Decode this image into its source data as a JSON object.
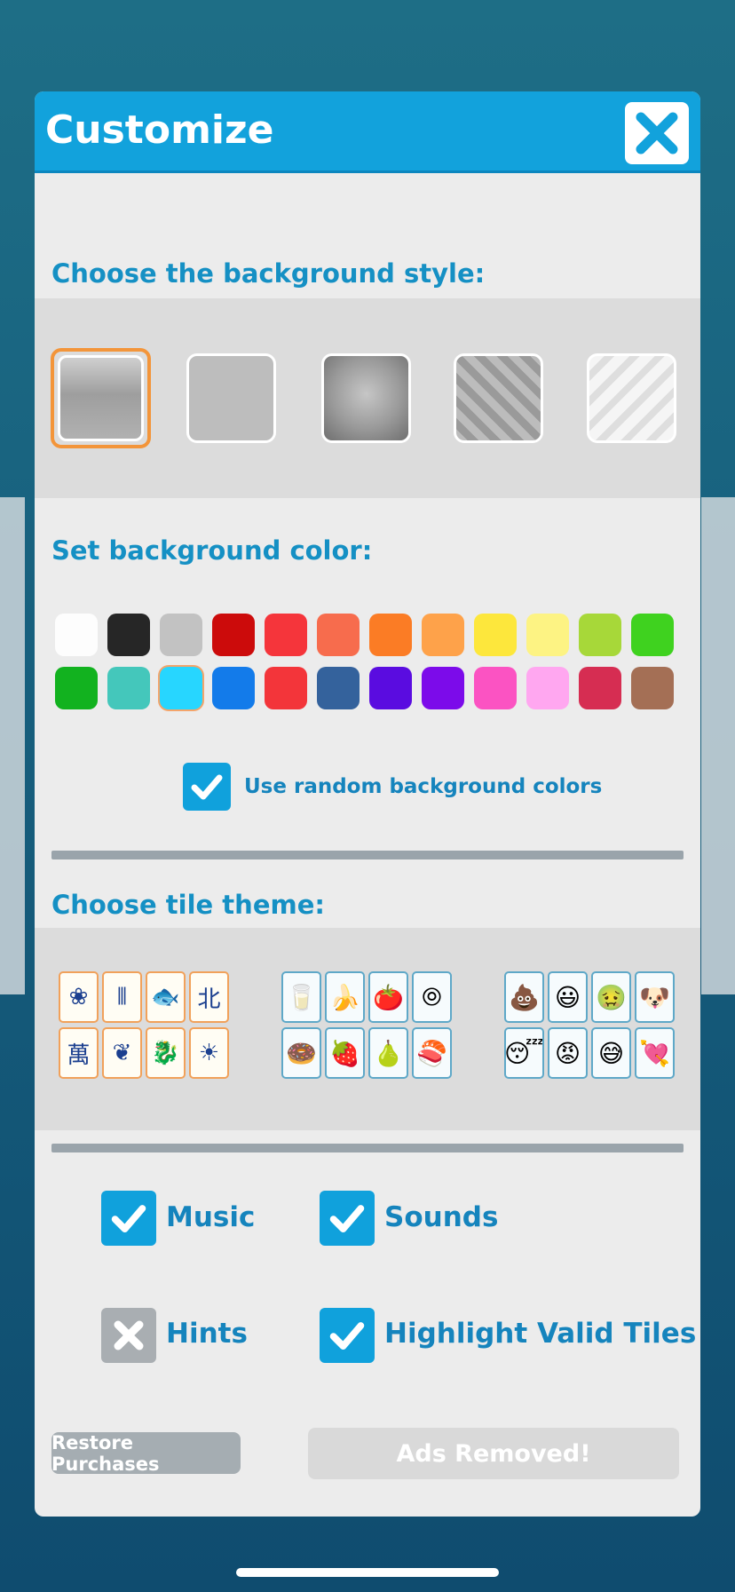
{
  "header": {
    "title": "Customize",
    "close_icon": "close-x-icon"
  },
  "background_style": {
    "label": "Choose the background style:",
    "options": [
      {
        "name": "solid-gradient",
        "selected": true
      },
      {
        "name": "flat"
      },
      {
        "name": "vignette"
      },
      {
        "name": "chevron"
      },
      {
        "name": "zigzag"
      }
    ]
  },
  "background_color": {
    "label": "Set background color:",
    "swatches_row1": [
      "#fdfdfd",
      "#262626",
      "#c2c2c2",
      "#cc0b0b",
      "#f5353b",
      "#f76c4d",
      "#fb7c25",
      "#fea24a",
      "#fde73c",
      "#fdf383",
      "#a7d839",
      "#3fd21f"
    ],
    "swatches_row2": [
      "#12b21f",
      "#44c7bb",
      "#27d6ff",
      "#137bea",
      "#f3353a",
      "#34629c",
      "#5a0ce0",
      "#7c0bea",
      "#fb53c2",
      "#ffa7f0",
      "#d62d52",
      "#a46f55"
    ],
    "selected_index_row2": 2,
    "random_label": "Use random background colors",
    "random_checked": true
  },
  "tile_theme": {
    "label": "Choose tile theme:",
    "themes": [
      {
        "name": "mahjong",
        "tiles": [
          "❀",
          "⫴",
          "🐟",
          "北",
          "萬",
          "❦",
          "🐉",
          "☀"
        ]
      },
      {
        "name": "food",
        "tiles": [
          "🥛",
          "🍌",
          "🍅",
          "⦾",
          "🍩",
          "🍓",
          "🍐",
          "🍣"
        ]
      },
      {
        "name": "emoji",
        "tiles": [
          "💩",
          "😃",
          "🤢",
          "🐶",
          "😴",
          "😡",
          "😅",
          "💘"
        ]
      }
    ]
  },
  "settings": {
    "music": {
      "label": "Music",
      "checked": true
    },
    "sounds": {
      "label": "Sounds",
      "checked": true
    },
    "hints": {
      "label": "Hints",
      "checked": false
    },
    "highlight": {
      "label": "Highlight Valid Tiles",
      "checked": true
    }
  },
  "buttons": {
    "restore": "Restore Purchases",
    "ads": "Ads Removed!"
  }
}
